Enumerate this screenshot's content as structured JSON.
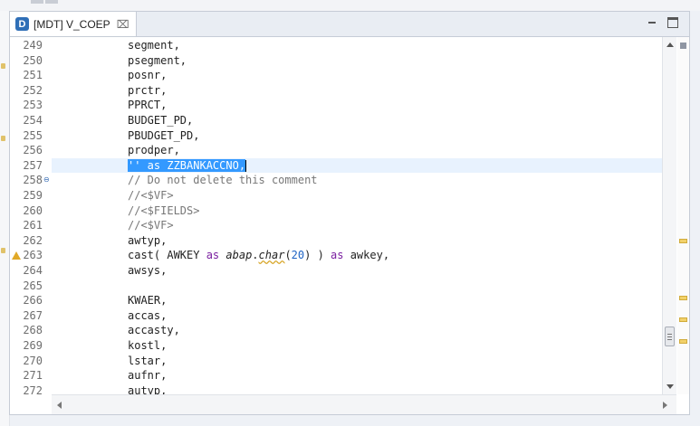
{
  "tab": {
    "icon_letter": "D",
    "title": "[MDT] V_COEP",
    "close_glyph": "⌧"
  },
  "editor": {
    "lines": [
      {
        "num": "249",
        "text": "segment,"
      },
      {
        "num": "250",
        "text": "psegment,"
      },
      {
        "num": "251",
        "text": "posnr,"
      },
      {
        "num": "252",
        "text": "prctr,"
      },
      {
        "num": "253",
        "text": "PPRCT,"
      },
      {
        "num": "254",
        "text": "BUDGET_PD,"
      },
      {
        "num": "255",
        "text": "PBUDGET_PD,"
      },
      {
        "num": "256",
        "text": "prodper,"
      },
      {
        "num": "257",
        "text": "'' as ZZBANKACCNO,",
        "selected": true
      },
      {
        "num": "258",
        "text": "// Do not delete this comment",
        "comment": true,
        "fold": true
      },
      {
        "num": "259",
        "text": "//<$VF>",
        "comment": true
      },
      {
        "num": "260",
        "text": "//<$FIELDS>",
        "comment": true
      },
      {
        "num": "261",
        "text": "//<$VF>",
        "comment": true
      },
      {
        "num": "262",
        "text": "awtyp,"
      },
      {
        "num": "263",
        "text": "cast( AWKEY as abap.char(20) ) as awkey,",
        "warning": true,
        "parts": {
          "a": "cast( AWKEY ",
          "kw1": "as",
          "b": " ",
          "i1": "abap",
          "dot": ".",
          "i2": "char",
          "p1": "(",
          "n": "20",
          "p2": ") ) ",
          "kw2": "as",
          "c": " awkey,"
        }
      },
      {
        "num": "264",
        "text": "awsys,"
      },
      {
        "num": "265",
        "text": ""
      },
      {
        "num": "266",
        "text": "KWAER,"
      },
      {
        "num": "267",
        "text": "accas,"
      },
      {
        "num": "268",
        "text": "accasty,"
      },
      {
        "num": "269",
        "text": "kostl,"
      },
      {
        "num": "270",
        "text": "lstar,"
      },
      {
        "num": "271",
        "text": "aufnr,"
      },
      {
        "num": "272",
        "text": "autyp,"
      }
    ]
  },
  "colors": {
    "selection": "#3399ff",
    "current_line": "#e8f2fe",
    "keyword": "#7a1fa0",
    "number": "#1e63c4",
    "comment": "#777777",
    "warning": "#e1a927"
  },
  "icons": [
    "d-file-icon",
    "close-icon",
    "minimize-icon",
    "maximize-icon",
    "fold-icon",
    "warning-icon"
  ]
}
